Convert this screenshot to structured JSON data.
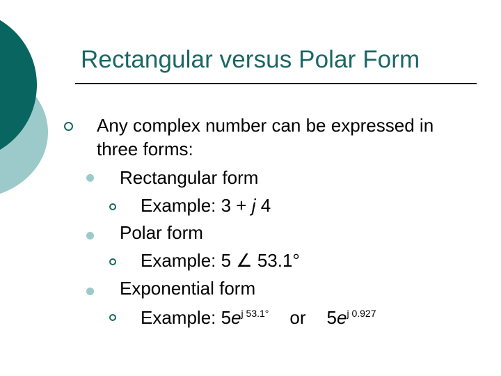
{
  "slide": {
    "title": "Rectangular versus Polar Form",
    "colors": {
      "accent_dark": "#08655f",
      "accent_light": "#9ccacb",
      "title": "#1a6763"
    },
    "bullets": {
      "main": {
        "line1": "Any complex number can be expressed in",
        "line2": "three forms:"
      },
      "rect": {
        "label": "Rectangular form",
        "example_prefix": "Example: 3 + ",
        "example_j": "j",
        "example_suffix": " 4"
      },
      "polar": {
        "label": "Polar form",
        "example_prefix": "Example: 5 ",
        "angle_symbol": "∠",
        "example_suffix": " 53.1°"
      },
      "exp": {
        "label": "Exponential form",
        "example_prefix": "Example: 5",
        "e1": "e",
        "sup1": "j 53.1°",
        "or": "or",
        "five2": "5",
        "e2": "e",
        "sup2": "j 0.927"
      }
    }
  }
}
